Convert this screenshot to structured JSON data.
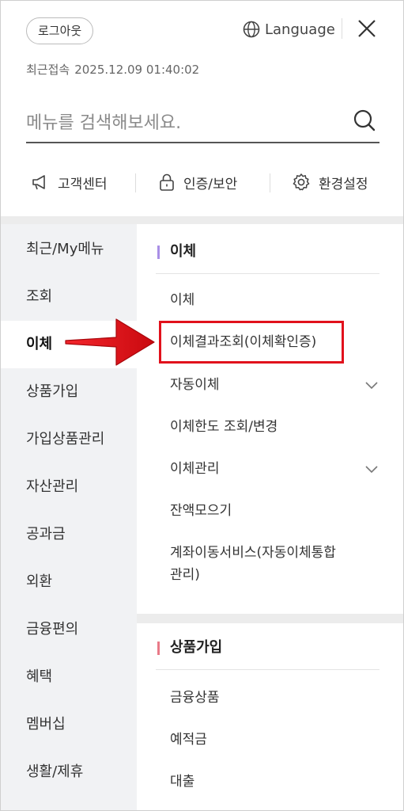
{
  "header": {
    "logout_label": "로그아웃",
    "language_label": "Language",
    "last_login_label": "최근접속",
    "last_login_value": "2025.12.09 01:40:02"
  },
  "search": {
    "placeholder": "메뉴를 검색해보세요."
  },
  "quick_links": [
    {
      "label": "고객센터",
      "icon": "megaphone-icon"
    },
    {
      "label": "인증/보안",
      "icon": "lock-icon"
    },
    {
      "label": "환경설정",
      "icon": "gear-icon"
    }
  ],
  "left_nav": {
    "active_index": 2,
    "items": [
      "최근/My메뉴",
      "조회",
      "이체",
      "상품가입",
      "가입상품관리",
      "자산관리",
      "공과금",
      "외환",
      "금융편의",
      "혜택",
      "멤버십",
      "생활/제휴"
    ]
  },
  "sections": [
    {
      "title": "이체",
      "bar_color": "#a98fe6",
      "items": [
        {
          "label": "이체",
          "expandable": false
        },
        {
          "label": "이체결과조회(이체확인증)",
          "expandable": false,
          "highlighted": true
        },
        {
          "label": "자동이체",
          "expandable": true
        },
        {
          "label": "이체한도 조회/변경",
          "expandable": false
        },
        {
          "label": "이체관리",
          "expandable": true
        },
        {
          "label": "잔액모으기",
          "expandable": false
        },
        {
          "label": "계좌이동서비스(자동이체통합",
          "label_line2": "관리)",
          "expandable": false
        }
      ]
    },
    {
      "title": "상품가입",
      "bar_color": "#e97a88",
      "items": [
        {
          "label": "금융상품"
        },
        {
          "label": "예적금"
        },
        {
          "label": "대출"
        }
      ]
    }
  ],
  "colors": {
    "annotation_red": "#e1111c"
  }
}
